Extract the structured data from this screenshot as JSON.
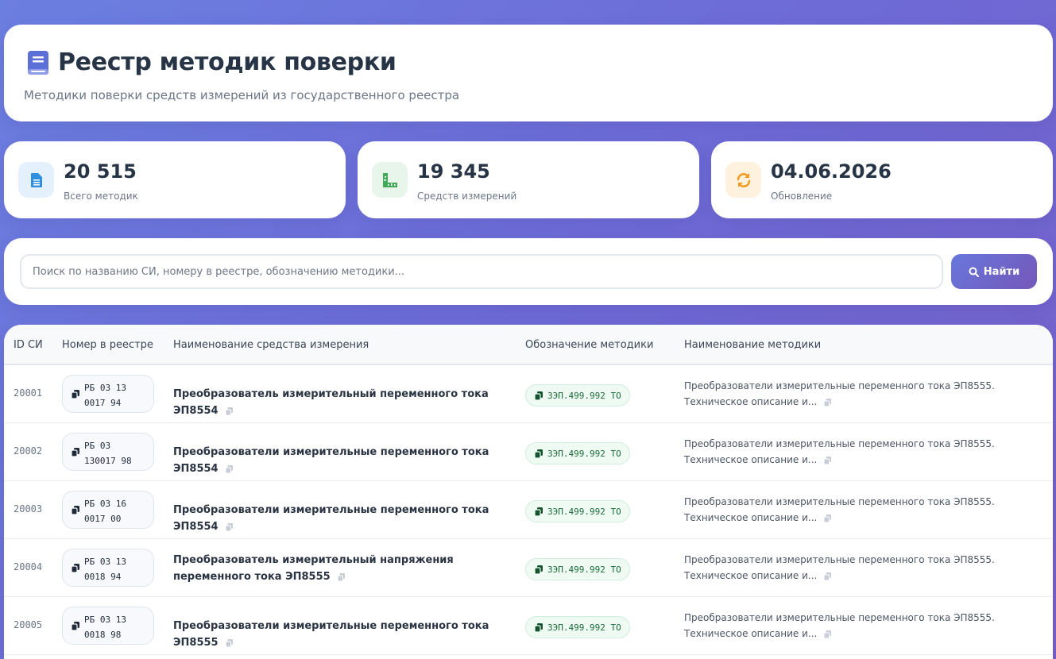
{
  "header": {
    "title": "Реестр методик поверки",
    "subtitle": "Методики поверки средств измерений из государственного реестра"
  },
  "stats": [
    {
      "value": "20 515",
      "label": "Всего методик",
      "icon": "document-icon",
      "color": "#2f8fe0",
      "bg": "#e4f1fd"
    },
    {
      "value": "19 345",
      "label": "Средств измерений",
      "icon": "ruler-icon",
      "color": "#43a857",
      "bg": "#e7f5ea"
    },
    {
      "value": "04.06.2026",
      "label": "Обновление",
      "icon": "sync-icon",
      "color": "#f39a1e",
      "bg": "#fef2df"
    }
  ],
  "search": {
    "placeholder": "Поиск по названию СИ, номеру в реестре, обозначению методики...",
    "button_label": "Найти"
  },
  "table": {
    "headers": [
      "ID СИ",
      "Номер в реестре",
      "Наименование средства измерения",
      "Обозначение методики",
      "Наименование методики"
    ],
    "rows": [
      {
        "id": "20001",
        "reg": "РБ 03 13\n0017 94",
        "si_name": "Преобразователь измерительный переменного тока ЭП8554",
        "method_code": "ЗЭП.499.992 ТО",
        "method_name": "Преобразователи измерительные переменного тока ЭП8555. Техническое описание и..."
      },
      {
        "id": "20002",
        "reg": "РБ 03\n130017 98",
        "si_name": "Преобразователи измерительные переменного тока ЭП8554",
        "method_code": "ЗЭП.499.992 ТО",
        "method_name": "Преобразователи измерительные переменного тока ЭП8555. Техническое описание и..."
      },
      {
        "id": "20003",
        "reg": "РБ 03 16\n0017 00",
        "si_name": "Преобразователи измерительные переменного тока ЭП8554",
        "method_code": "ЗЭП.499.992 ТО",
        "method_name": "Преобразователи измерительные переменного тока ЭП8555. Техническое описание и..."
      },
      {
        "id": "20004",
        "reg": "РБ 03 13\n0018 94",
        "si_name": "Преобразователь измерительный напряжения переменного тока ЭП8555",
        "method_code": "ЗЭП.499.992 ТО",
        "method_name": "Преобразователи измерительные переменного тока ЭП8555. Техническое описание и..."
      },
      {
        "id": "20005",
        "reg": "РБ 03 13\n0018 98",
        "si_name": "Преобразователи измерительные переменного тока ЭП8555",
        "method_code": "ЗЭП.499.992 ТО",
        "method_name": "Преобразователи измерительные переменного тока ЭП8555. Техническое описание и..."
      }
    ]
  }
}
